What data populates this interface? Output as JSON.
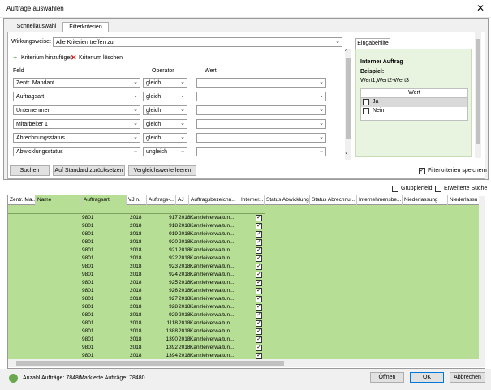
{
  "window": {
    "title": "Aufträge auswählen",
    "close_glyph": "✕"
  },
  "tabs": [
    {
      "label": "Schnellauswahl"
    },
    {
      "label": "Filterkriterien"
    }
  ],
  "filter": {
    "wirkungsweise_label": "Wirkungsweise:",
    "wirkungsweise_value": "Alle Kriterien treffen zu",
    "add_label": "Kriterium hinzufügen",
    "delete_label": "Kriterium löschen",
    "col_feld": "Feld",
    "col_operator": "Operator",
    "col_wert": "Wert",
    "rows": [
      {
        "feld": "Zentr. Mandant",
        "op": "gleich",
        "wert": ""
      },
      {
        "feld": "Auftragsart",
        "op": "gleich",
        "wert": ""
      },
      {
        "feld": "Unternehmen",
        "op": "gleich",
        "wert": ""
      },
      {
        "feld": "Mitarbeiter 1",
        "op": "gleich",
        "wert": ""
      },
      {
        "feld": "Abrechnungsstatus",
        "op": "gleich",
        "wert": ""
      },
      {
        "feld": "Abwicklungsstatus",
        "op": "ungleich",
        "wert": ""
      }
    ]
  },
  "eingabehilfe": {
    "title": "Eingabehilfe",
    "heading": "Interner Auftrag",
    "beispiel_label": "Beispiel:",
    "beispiel_value": "Wert1;Wert2-Wert3",
    "list_header": "Wert",
    "options": [
      {
        "label": "Ja"
      },
      {
        "label": "Nein"
      }
    ]
  },
  "buttons": {
    "suchen": "Suchen",
    "standard": "Auf Standard zurücksetzen",
    "vergleich": "Vergleichswerte leeren",
    "save_label": "Filterkriterien speichern",
    "gruppierfeld": "Gruppierfeld",
    "erweiterte": "Erweiterte Suche",
    "oeffnen": "Öffnen",
    "ok": "OK",
    "abbrechen": "Abbrechen"
  },
  "grid": {
    "columns": [
      "Zentr. Ma...",
      "Name",
      "Auftragsart",
      "VJ n.",
      "Auftrags-...",
      "AJ",
      "Auftragsbezeichn...",
      "Interner...",
      "Status Abwicklung",
      "Status  Abrechnu...",
      "Internehmensbe...",
      "Niederlassung",
      "Niederlassu"
    ],
    "rows": [
      {
        "art": "",
        "vj": "",
        "nr": "",
        "aj": "",
        "bez": ""
      },
      {
        "art": "9801",
        "vj": "2018",
        "nr": "917",
        "aj": "2018",
        "bez": "Kanzleiverwaltun..."
      },
      {
        "art": "9801",
        "vj": "2018",
        "nr": "918",
        "aj": "2018",
        "bez": "Kanzleiverwaltun..."
      },
      {
        "art": "9801",
        "vj": "2018",
        "nr": "919",
        "aj": "2018",
        "bez": "Kanzleiverwaltun..."
      },
      {
        "art": "9801",
        "vj": "2018",
        "nr": "920",
        "aj": "2018",
        "bez": "Kanzleiverwaltun..."
      },
      {
        "art": "9801",
        "vj": "2018",
        "nr": "921",
        "aj": "2018",
        "bez": "Kanzleiverwaltun..."
      },
      {
        "art": "9801",
        "vj": "2018",
        "nr": "922",
        "aj": "2018",
        "bez": "Kanzleiverwaltun..."
      },
      {
        "art": "9801",
        "vj": "2018",
        "nr": "923",
        "aj": "2018",
        "bez": "Kanzleiverwaltun..."
      },
      {
        "art": "9801",
        "vj": "2018",
        "nr": "924",
        "aj": "2018",
        "bez": "Kanzleiverwaltun..."
      },
      {
        "art": "9801",
        "vj": "2018",
        "nr": "925",
        "aj": "2018",
        "bez": "Kanzleiverwaltun..."
      },
      {
        "art": "9801",
        "vj": "2018",
        "nr": "926",
        "aj": "2018",
        "bez": "Kanzleiverwaltun..."
      },
      {
        "art": "9801",
        "vj": "2018",
        "nr": "927",
        "aj": "2018",
        "bez": "Kanzleiverwaltun..."
      },
      {
        "art": "9801",
        "vj": "2018",
        "nr": "928",
        "aj": "2018",
        "bez": "Kanzleiverwaltun..."
      },
      {
        "art": "9801",
        "vj": "2018",
        "nr": "929",
        "aj": "2018",
        "bez": "Kanzleiverwaltun..."
      },
      {
        "art": "9801",
        "vj": "2018",
        "nr": "1118",
        "aj": "2018",
        "bez": "Kanzleiverwaltun..."
      },
      {
        "art": "9801",
        "vj": "2018",
        "nr": "1388",
        "aj": "2018",
        "bez": "Kanzleiverwaltun..."
      },
      {
        "art": "9801",
        "vj": "2018",
        "nr": "1390",
        "aj": "2018",
        "bez": "Kanzleiverwaltun..."
      },
      {
        "art": "9801",
        "vj": "2018",
        "nr": "1392",
        "aj": "2018",
        "bez": "Kanzleiverwaltun..."
      },
      {
        "art": "9801",
        "vj": "2018",
        "nr": "1394",
        "aj": "2018",
        "bez": "Kanzleiverwaltun..."
      }
    ]
  },
  "status": {
    "anzahl": "Anzahl Aufträge: 78480",
    "markiert": "Markierte Aufträge: 78480"
  },
  "colors": {
    "green": "#b6de94",
    "help_panel": "#e8f4df"
  }
}
